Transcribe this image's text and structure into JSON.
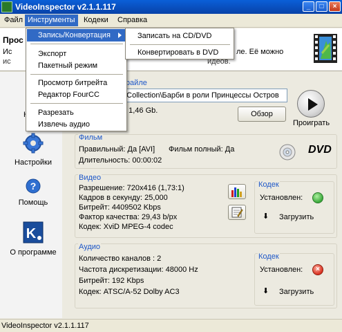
{
  "window": {
    "title": "VideoInspector v2.1.1.117"
  },
  "menu": {
    "file": "Файл",
    "tools": "Инструменты",
    "codecs": "Кодеки",
    "help": "Справка"
  },
  "tools_menu": {
    "items": [
      "Запись/Конвертация",
      "Экспорт",
      "Пакетный режим",
      "Просмотр битрейта",
      "Редактор FourCC",
      "Разрезать",
      "Извлечь аудио"
    ]
  },
  "submenu": {
    "items": [
      "Записать на CD/DVD",
      "Конвертировать в DVD"
    ]
  },
  "header": {
    "title": "Прос",
    "line1_left": "Ис",
    "line1_right": "ле. Её можно",
    "line2": "ис",
    "line2_right": "идеов."
  },
  "sidebar": {
    "items": [
      {
        "label": "К",
        "icon": "film-icon"
      },
      {
        "label": "Настройки",
        "icon": "gear-icon"
      },
      {
        "label": "Помощь",
        "icon": "help-icon"
      },
      {
        "label": "О программе",
        "icon": "about-icon"
      }
    ]
  },
  "file": {
    "group_label": "файле",
    "path": "e Collection\\Барби в роли Принцессы Остров",
    "size": ": 1,46 Gb.",
    "browse_label": "Обзор",
    "play_label": "Проиграть"
  },
  "film": {
    "group_label": "Фильм",
    "correct": "Правильный: Да [AVI]",
    "full": "Фильм полный: Да",
    "duration": "Длительность: 00:00:02",
    "dvd_logo": "DVD"
  },
  "video": {
    "group_label": "Видео",
    "resolution": "Разрешение: 720x416 (1,73:1)",
    "fps": "Кадров в секунду: 25,000",
    "bitrate": "Битрейт: 4409502 Kbps",
    "quality": "Фактор качества: 29,43 b/px",
    "codec": "Кодек: XviD MPEG-4 codec",
    "codec_group": "Кодек",
    "installed": "Установлен:",
    "status": "ok",
    "download": "Загрузить"
  },
  "audio": {
    "group_label": "Аудио",
    "channels": "Количество каналов : 2",
    "sample_rate": "Частота дискретизации: 48000 Hz",
    "bitrate": "Битрейт: 192 Kbps",
    "codec": "Кодек: ATSC/A-52 Dolby AC3",
    "codec_group": "Кодек",
    "installed": "Установлен:",
    "status": "error",
    "download": "Загрузить"
  },
  "statusbar": {
    "text": "VideoInspector v2.1.1.117"
  },
  "colors": {
    "accent": "#316ac5",
    "group_label": "#1d57c8",
    "titlebar": "#0a5fd8"
  }
}
